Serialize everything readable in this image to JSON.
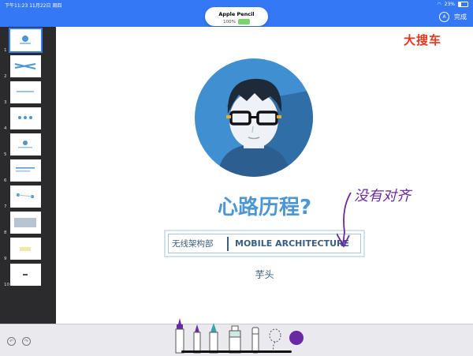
{
  "status_bar": {
    "time_date": "下午11:23   11月22日 周四",
    "battery": "23%",
    "done_label": "完成",
    "markup_icon": "A"
  },
  "pencil_popup": {
    "name": "Apple Pencil",
    "battery": "100%"
  },
  "sidebar": {
    "thumbnails": [
      {
        "num": "1"
      },
      {
        "num": "2"
      },
      {
        "num": "3"
      },
      {
        "num": "4"
      },
      {
        "num": "5"
      },
      {
        "num": "6"
      },
      {
        "num": "7"
      },
      {
        "num": "8"
      },
      {
        "num": "9"
      },
      {
        "num": "10"
      }
    ],
    "add_label": "+"
  },
  "slide": {
    "logo": "大搜车",
    "title": "心路历程?",
    "department_cn": "无线架构部",
    "department_en": "MOBILE ARCHITECTURE",
    "author": "芋头",
    "annotation": "没有对齐"
  },
  "colors": {
    "accent": "#3478f6",
    "title_blue": "#4b96d3",
    "logo_red": "#e7361c",
    "ink_purple": "#6a29a2"
  },
  "toolbar": {
    "tools": [
      "pen-icon",
      "pencil-icon",
      "marker-icon",
      "highlighter-icon",
      "eraser-icon",
      "lasso-icon"
    ],
    "selected_color": "#6a29a2"
  }
}
